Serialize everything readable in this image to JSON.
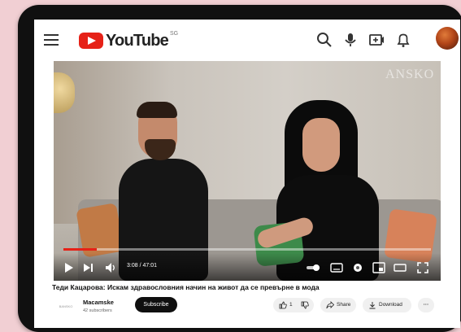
{
  "app": {
    "logo_text": "YouTube",
    "region": "SG"
  },
  "video": {
    "watermark": "ANSKO",
    "progress_fraction": 0.09,
    "time_current": "3:08",
    "time_total": "47:01"
  },
  "info": {
    "title": "Теди Кацарова: Искам здравословния начин на живот да се превърне в мода",
    "channel_logo": "BANSKO",
    "channel_name": "Macamske",
    "subscribers": "42 subscribers",
    "subscribe_label": "Subscribe",
    "like_count": "1",
    "share_label": "Share",
    "download_label": "Download"
  },
  "icons": [
    "menu-icon",
    "search-icon",
    "mic-icon",
    "create-icon",
    "bell-icon",
    "play-icon",
    "next-icon",
    "volume-icon",
    "autoplay-toggle",
    "captions-icon",
    "settings-icon",
    "miniplayer-icon",
    "theater-icon",
    "fullscreen-icon",
    "like-icon",
    "dislike-icon",
    "share-icon",
    "download-icon",
    "more-icon"
  ],
  "colors": {
    "accent": "#e62117",
    "tablet": "#101010",
    "background": "#f1cfd3"
  }
}
